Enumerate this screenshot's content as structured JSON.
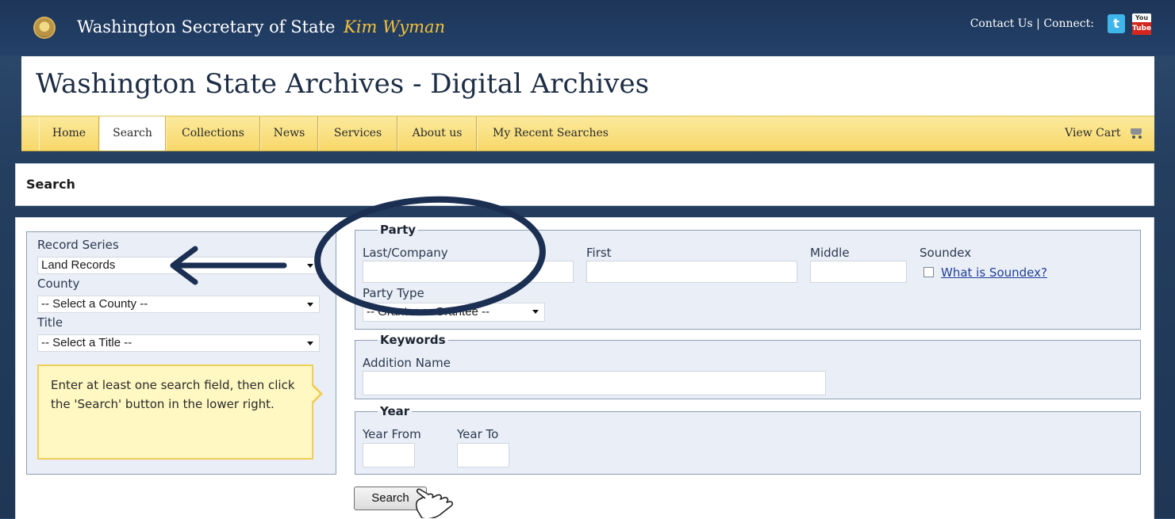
{
  "header": {
    "brand": "Washington Secretary of State",
    "brand_name": "Kim Wyman",
    "contact_link": "Contact Us",
    "separator": " | ",
    "connect_label": "Connect:",
    "twitter_icon": "twitter-icon",
    "youtube_icon": "youtube-icon",
    "youtube_you": "You",
    "youtube_tube": "Tube"
  },
  "site_title": "Washington State Archives - Digital Archives",
  "nav": {
    "items": [
      {
        "label": "Home"
      },
      {
        "label": "Search",
        "active": true
      },
      {
        "label": "Collections"
      },
      {
        "label": "News"
      },
      {
        "label": "Services"
      },
      {
        "label": "About us"
      },
      {
        "label": "My Recent Searches"
      }
    ],
    "cart_label": "View Cart",
    "cart_icon": "cart-icon"
  },
  "page_heading": "Search",
  "filters": {
    "record_series_label": "Record Series",
    "record_series_value": "Land Records",
    "county_label": "County",
    "county_value": "-- Select a County --",
    "title_label": "Title",
    "title_value": "-- Select a Title --",
    "tip": "Enter at least one search field, then click the 'Search' button in the lower right."
  },
  "party": {
    "legend": "Party",
    "last_label": "Last/Company",
    "first_label": "First",
    "middle_label": "Middle",
    "soundex_label": "Soundex",
    "soundex_link": "What is Soundex?",
    "party_type_label": "Party Type",
    "party_type_value": "-- Grantor or Grantee --"
  },
  "keywords": {
    "legend": "Keywords",
    "addition_label": "Addition Name"
  },
  "year": {
    "legend": "Year",
    "from_label": "Year From",
    "to_label": "Year To"
  },
  "search_button": "Search",
  "colors": {
    "header_bg": "#1d3557",
    "brand_name": "#f3c13a",
    "nav_bg": "#f7d86a",
    "panel_bg": "#eaeef6",
    "annotation": "#1b2f52"
  }
}
